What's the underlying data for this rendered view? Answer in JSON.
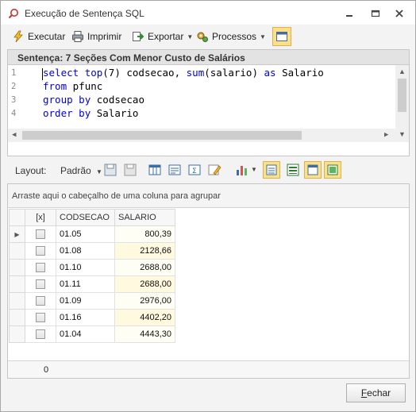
{
  "window": {
    "title": "Execução de Sentença SQL",
    "icon": "magnifier-sql-icon"
  },
  "toolbar": {
    "execute_label": "Executar",
    "print_label": "Imprimir",
    "export_label": "Exportar",
    "processes_label": "Processos"
  },
  "sql": {
    "header": "Sentença: 7 Seções Com Menor Custo de Salários",
    "line_numbers": [
      "1",
      "2",
      "3",
      "4"
    ],
    "lines": [
      "select top(7) codsecao, sum(salario) as Salario",
      "from pfunc",
      "group by codsecao",
      "order by Salario"
    ]
  },
  "layout_bar": {
    "label": "Layout:",
    "preset": "Padrão"
  },
  "grid": {
    "group_hint": "Arraste aqui o cabeçalho de uma coluna para agrupar",
    "columns": [
      "[x]",
      "CODSECAO",
      "SALARIO"
    ],
    "rows": [
      {
        "codsecao": "01.05",
        "salario": "800,39"
      },
      {
        "codsecao": "01.08",
        "salario": "2128,66"
      },
      {
        "codsecao": "01.10",
        "salario": "2688,00"
      },
      {
        "codsecao": "01.11",
        "salario": "2688,00"
      },
      {
        "codsecao": "01.09",
        "salario": "2976,00"
      },
      {
        "codsecao": "01.16",
        "salario": "4402,20"
      },
      {
        "codsecao": "01.04",
        "salario": "4443,30"
      }
    ],
    "footer_count": "0"
  },
  "buttons": {
    "close_first": "F",
    "close_rest": "echar"
  },
  "colors": {
    "keyword": "#0000e0",
    "toggle_active": "#fbe08a"
  }
}
